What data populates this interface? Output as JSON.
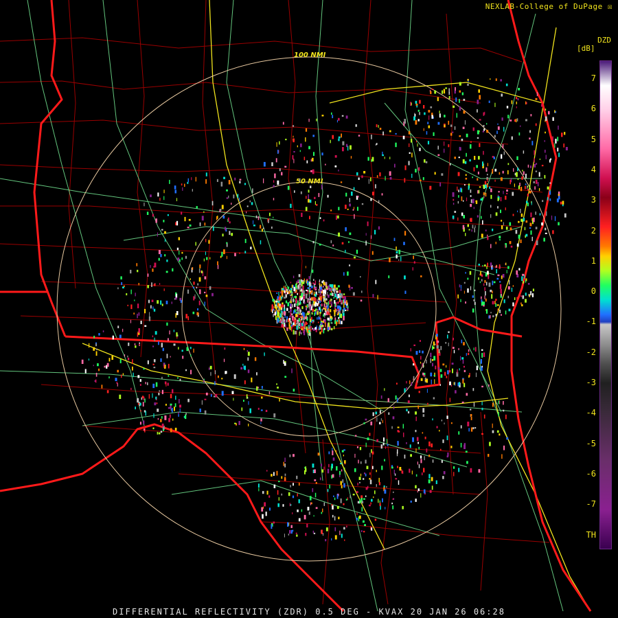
{
  "credit": "NEXLAB-College of DuPage",
  "footer": "DIFFERENTIAL REFLECTIVITY (ZDR) 0.5 DEG - KVAX 20 JAN 26 06:28",
  "rings": {
    "outer_label": "100 NMI",
    "inner_label": "50 NMI"
  },
  "legend": {
    "product": "DZD",
    "unit": "[dB]",
    "ticks": [
      "7",
      "6",
      "5",
      "4",
      "3",
      "2",
      "1",
      "0",
      "-1",
      "-2",
      "-3",
      "-4",
      "-5",
      "-6",
      "-7",
      "TH"
    ]
  },
  "colors": {
    "state_border": "#ff1a1a",
    "county_border": "#a00000",
    "highway": "#f2e51d",
    "road": "#6fdc8c",
    "range_ring": "#e8c9a0",
    "label": "#f2e51d"
  },
  "icons": {
    "credit_badge": "tcp-logo-icon"
  }
}
